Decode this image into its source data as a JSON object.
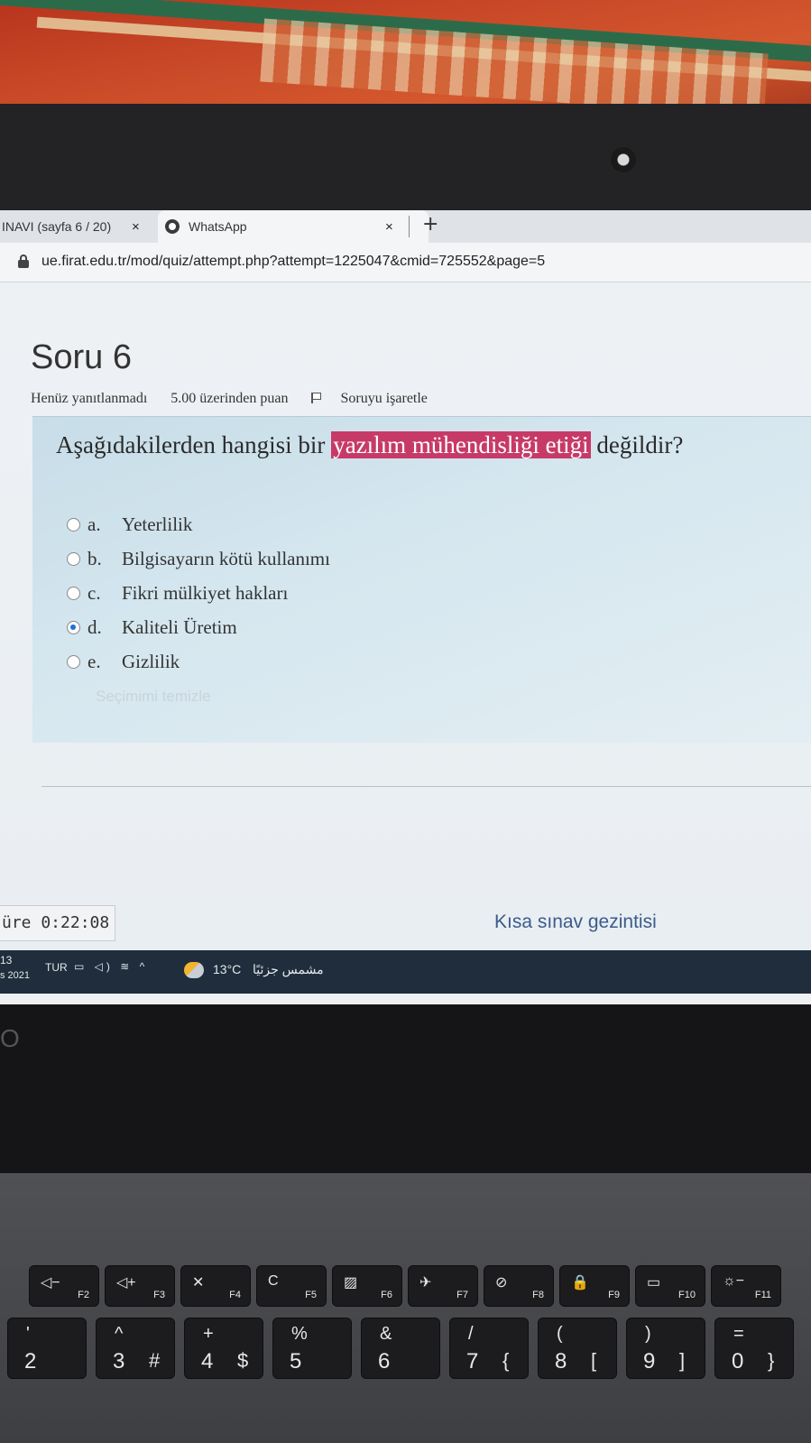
{
  "browser": {
    "tabs": [
      {
        "label": "INAVI (sayfa 6 / 20)",
        "close": "×"
      },
      {
        "label": "WhatsApp",
        "close": "×",
        "icon": "whatsapp-icon"
      }
    ],
    "new_tab": "+",
    "url": "ue.firat.edu.tr/mod/quiz/attempt.php?attempt=1225047&cmid=725552&page=5"
  },
  "question": {
    "title": "Soru 6",
    "status": "Henüz yanıtlanmadı",
    "points": "5.00 üzerinden puan",
    "flag_label": "Soruyu işaretle",
    "text_before": "Aşağıdakilerden hangisi bir ",
    "text_highlight": "yazılım mühendisliği etiği",
    "text_after": " değildir?",
    "highlight_color": "#c73a68",
    "options": [
      {
        "letter": "a.",
        "text": "Yeterlilik",
        "selected": false
      },
      {
        "letter": "b.",
        "text": "Bilgisayarın kötü kullanımı",
        "selected": false
      },
      {
        "letter": "c.",
        "text": "Fikri mülkiyet hakları",
        "selected": false
      },
      {
        "letter": "d.",
        "text": "Kaliteli Üretim",
        "selected": true
      },
      {
        "letter": "e.",
        "text": "Gizlilik",
        "selected": false
      }
    ],
    "clear_choice": "Seçimimi temizle"
  },
  "footer": {
    "timer": "üre 0:22:08",
    "nav_link": "Kısa sınav gezintisi"
  },
  "taskbar": {
    "time": "13",
    "date": "s 2021",
    "language": "TUR",
    "temperature": "13°C",
    "condition": "مشمس جزئيًا"
  },
  "laptop": {
    "brand": "O",
    "fkeys": [
      {
        "symbol": "◁−",
        "label": "F2"
      },
      {
        "symbol": "◁+",
        "label": "F3"
      },
      {
        "symbol": "✕",
        "label": "F4"
      },
      {
        "symbol": "C",
        "label": "F5"
      },
      {
        "symbol": "▨",
        "label": "F6"
      },
      {
        "symbol": "✈",
        "label": "F7"
      },
      {
        "symbol": "⊘",
        "label": "F8"
      },
      {
        "symbol": "🔒",
        "label": "F9"
      },
      {
        "symbol": "▭",
        "label": "F10"
      },
      {
        "symbol": "☼−",
        "label": "F11"
      }
    ],
    "numkeys": [
      {
        "upper": "'",
        "main": "2",
        "alt": ""
      },
      {
        "upper": "^",
        "main": "3",
        "alt": "#"
      },
      {
        "upper": "+",
        "main": "4",
        "alt": "$"
      },
      {
        "upper": "%",
        "main": "5",
        "alt": ""
      },
      {
        "upper": "&",
        "main": "6",
        "alt": ""
      },
      {
        "upper": "/",
        "main": "7",
        "alt": "{"
      },
      {
        "upper": "(",
        "main": "8",
        "alt": "["
      },
      {
        "upper": ")",
        "main": "9",
        "alt": "]"
      },
      {
        "upper": "=",
        "main": "0",
        "alt": "}"
      }
    ]
  }
}
